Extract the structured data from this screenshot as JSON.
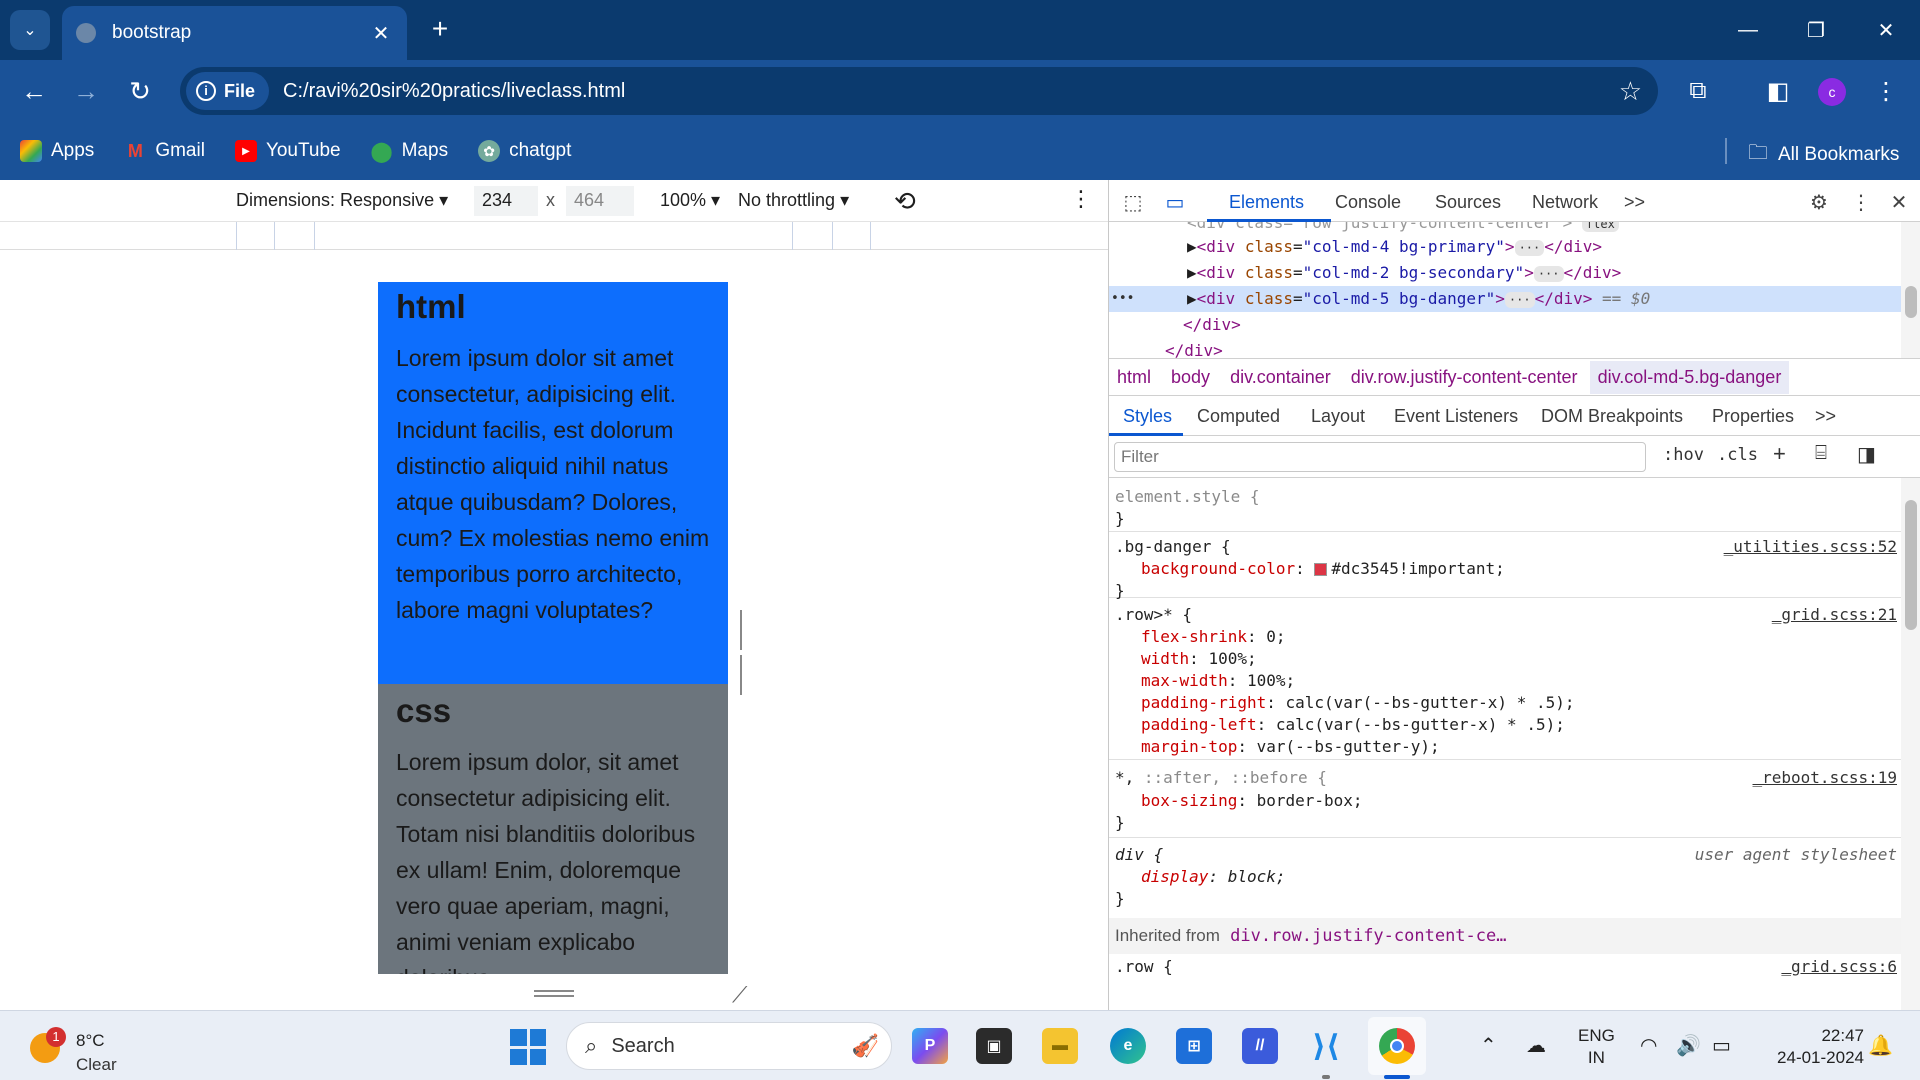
{
  "browser": {
    "tab_title": "bootstrap",
    "tab_close": "✕",
    "new_tab": "+",
    "site_chip": "File",
    "url": "C:/ravi%20sir%20pratics/liveclass.html",
    "profile_initial": "c",
    "bookmarks": [
      {
        "label": "Apps",
        "icon": "apps-grid-icon"
      },
      {
        "label": "Gmail",
        "icon": "gmail-icon"
      },
      {
        "label": "YouTube",
        "icon": "youtube-icon"
      },
      {
        "label": "Maps",
        "icon": "maps-icon"
      },
      {
        "label": "chatgpt",
        "icon": "chatgpt-icon"
      }
    ],
    "all_bookmarks": "All Bookmarks"
  },
  "device_toolbar": {
    "dimensions_label": "Dimensions: Responsive",
    "width": "234",
    "times": "x",
    "height": "464",
    "zoom": "100%",
    "throttling": "No throttling"
  },
  "page": {
    "sections": [
      {
        "heading": "html",
        "text": "Lorem ipsum dolor sit amet consectetur, adipisicing elit. Incidunt facilis, est dolorum distinctio aliquid nihil natus atque quibusdam? Dolores, cum? Ex molestias nemo enim temporibus porro architecto, labore magni voluptates?",
        "color": "#0d6efd"
      },
      {
        "heading": "css",
        "text": "Lorem ipsum dolor, sit amet consectetur adipisicing elit. Totam nisi blanditiis doloribus ex ullam! Enim, doloremque vero quae aperiam, magni, animi veniam explicabo doloribus",
        "color": "#6c757d"
      }
    ]
  },
  "devtools": {
    "tabs": {
      "elements": "Elements",
      "console": "Console",
      "sources": "Sources",
      "network": "Network",
      "more": ">>"
    },
    "dom": {
      "line0": "<div class=\"row justify-content-center\">",
      "line0_badge": "flex",
      "line1_tag_open": "<div",
      "line1_attr": "class",
      "line1_val": "\"col-md-4 bg-primary\"",
      "line2_val": "\"col-md-2 bg-secondary\"",
      "line3_val": "\"col-md-5 bg-danger\"",
      "close_div": "</div>",
      "dots": "···",
      "selected_marker": "== $0",
      "row_dots": "•••"
    },
    "breadcrumbs": [
      "html",
      "body",
      "div.container",
      "div.row.justify-content-center",
      "div.col-md-5.bg-danger"
    ],
    "sub_tabs": {
      "styles": "Styles",
      "computed": "Computed",
      "layout": "Layout",
      "listeners": "Event Listeners",
      "dom_bp": "DOM Breakpoints",
      "properties": "Properties",
      "more": ">>"
    },
    "filter_placeholder": "Filter",
    "hov": ":hov",
    "cls": ".cls",
    "rules": {
      "element_style": "element.style {",
      "close": "}",
      "bg_danger_sel": ".bg-danger {",
      "bg_danger_src": "_utilities.scss:52",
      "bg_danger_prop": "background-color",
      "bg_danger_val": "#dc3545!important;",
      "row_sel": ".row>* {",
      "row_src": "_grid.scss:21",
      "row_props": [
        {
          "name": "flex-shrink",
          "value": "0;"
        },
        {
          "name": "width",
          "value": "100%;"
        },
        {
          "name": "max-width",
          "value": "100%;"
        },
        {
          "name": "padding-right",
          "value": "calc(var(--bs-gutter-x) * .5);"
        },
        {
          "name": "padding-left",
          "value": "calc(var(--bs-gutter-x) * .5);"
        },
        {
          "name": "margin-top",
          "value": "var(--bs-gutter-y);"
        }
      ],
      "universal_sel_star": "*,",
      "universal_sel_rest": "::after, ::before {",
      "universal_src": "_reboot.scss:19",
      "universal_prop": "box-sizing",
      "universal_val": "border-box;",
      "div_sel": "div {",
      "div_src": "user agent stylesheet",
      "div_prop": "display",
      "div_val": "block;"
    },
    "inherited_label": "Inherited from",
    "inherited_link": "div.row.justify-content-ce…",
    "next_rule_sel": ".row {",
    "next_rule_src": "_grid.scss:6"
  },
  "taskbar": {
    "weather_badge": "1",
    "temperature": "8°C",
    "condition": "Clear",
    "search_label": "Search",
    "lang_top": "ENG",
    "lang_bottom": "IN",
    "time": "22:47",
    "date": "24-01-2024"
  }
}
